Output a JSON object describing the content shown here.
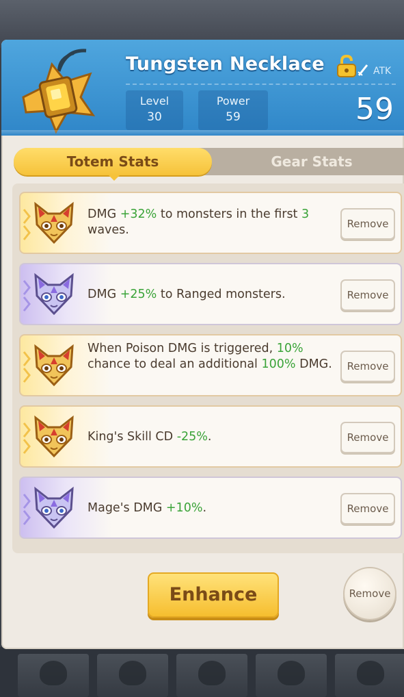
{
  "item": {
    "name": "Tungsten Necklace",
    "stat_type": "ATK",
    "big_value": "59",
    "level_label": "Level",
    "level_value": "30",
    "power_label": "Power",
    "power_value": "59",
    "icon": "gold-necklace-icon"
  },
  "tabs": [
    {
      "label": "Totem Stats",
      "active": true
    },
    {
      "label": "Gear Stats",
      "active": false
    }
  ],
  "totem_stats": [
    {
      "rarity": "gold",
      "icon": "gold-cat-mask-icon",
      "parts": [
        [
          "DMG ",
          ""
        ],
        [
          "+32%",
          "hl"
        ],
        [
          " to monsters in the first ",
          ""
        ],
        [
          "3",
          "hl"
        ],
        [
          " waves.",
          ""
        ]
      ],
      "button": "Remove"
    },
    {
      "rarity": "purple",
      "icon": "purple-cat-mask-icon",
      "parts": [
        [
          "DMG ",
          ""
        ],
        [
          "+25%",
          "hl"
        ],
        [
          " to Ranged monsters.",
          ""
        ]
      ],
      "button": "Remove"
    },
    {
      "rarity": "gold",
      "icon": "gold-cat-mask-icon",
      "parts": [
        [
          "When Poison DMG is triggered, ",
          ""
        ],
        [
          "10%",
          "hl"
        ],
        [
          " chance to deal an additional ",
          ""
        ],
        [
          "100%",
          "hl"
        ],
        [
          " DMG.",
          ""
        ]
      ],
      "button": "Remove"
    },
    {
      "rarity": "gold",
      "icon": "gold-cat-mask-icon",
      "parts": [
        [
          "King's Skill CD ",
          ""
        ],
        [
          "-25%",
          "hl"
        ],
        [
          ".",
          ""
        ]
      ],
      "button": "Remove"
    },
    {
      "rarity": "purple",
      "icon": "purple-cat-mask-icon",
      "parts": [
        [
          "Mage's DMG ",
          ""
        ],
        [
          "+10%",
          "hl"
        ],
        [
          ".",
          ""
        ]
      ],
      "button": "Remove"
    }
  ],
  "actions": {
    "enhance_label": "Enhance",
    "remove_label": "Remove"
  },
  "colors": {
    "header_blue": "#3a93d3",
    "gold_button": "#f6c23a",
    "highlight_green": "#3aa338",
    "text_brown": "#4a3b2e"
  }
}
